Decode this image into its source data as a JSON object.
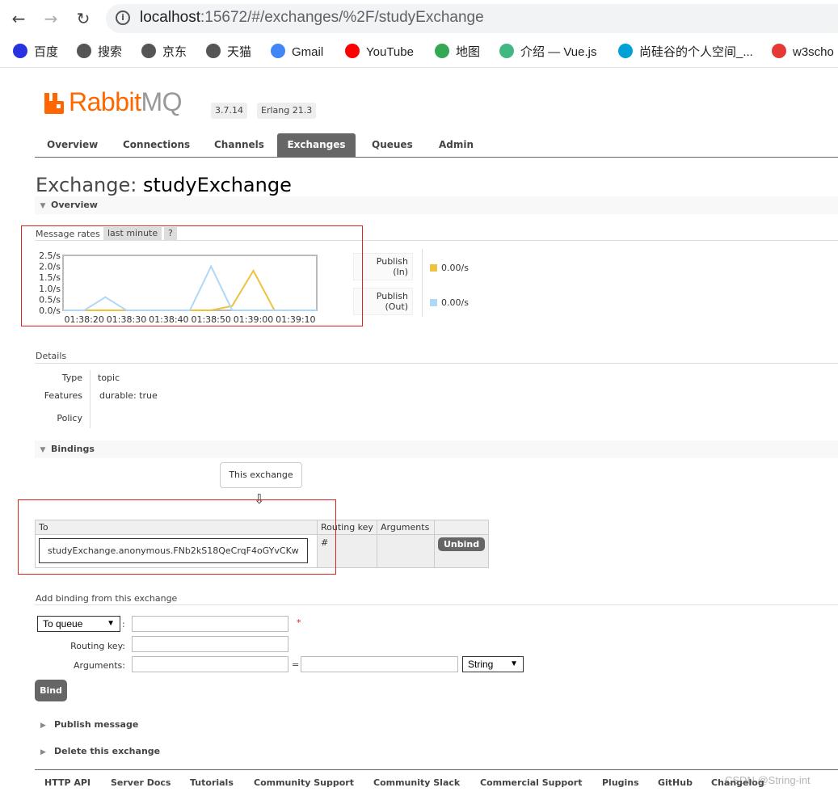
{
  "browser": {
    "url_host": "localhost",
    "url_rest": ":15672/#/exchanges/%2F/studyExchange",
    "bookmarks": [
      {
        "label": "百度",
        "icon": "baidu-icon",
        "color": "#2932e1"
      },
      {
        "label": "搜索",
        "icon": "globe-icon",
        "color": "#555555"
      },
      {
        "label": "京东",
        "icon": "globe-icon",
        "color": "#555555"
      },
      {
        "label": "天猫",
        "icon": "globe-icon",
        "color": "#555555"
      },
      {
        "label": "Gmail",
        "icon": "google-icon",
        "color": "#4285f4"
      },
      {
        "label": "YouTube",
        "icon": "youtube-icon",
        "color": "#ff0000"
      },
      {
        "label": "地图",
        "icon": "maps-icon",
        "color": "#34a853"
      },
      {
        "label": "介绍 — Vue.js",
        "icon": "vue-icon",
        "color": "#41b883"
      },
      {
        "label": "尚硅谷的个人空间_...",
        "icon": "bilibili-icon",
        "color": "#00a1d6"
      },
      {
        "label": "w3scho",
        "icon": "w3school-icon",
        "color": "#e53935"
      }
    ]
  },
  "header": {
    "logo_rabbit": "Rabbit",
    "logo_mq": "MQ",
    "version": "3.7.14",
    "erlang": "Erlang 21.3"
  },
  "tabs": [
    "Overview",
    "Connections",
    "Channels",
    "Exchanges",
    "Queues",
    "Admin"
  ],
  "title": {
    "prefix": "Exchange:",
    "name": "studyExchange"
  },
  "overview": {
    "heading": "Overview",
    "rates_label": "Message rates",
    "range_label": "last minute",
    "help_label": "?",
    "legend": [
      {
        "label_1": "Publish",
        "label_2": "(In)",
        "value": "0.00/s",
        "color": "#edc240"
      },
      {
        "label_1": "Publish",
        "label_2": "(Out)",
        "value": "0.00/s",
        "color": "#afd8f8"
      }
    ]
  },
  "chart_data": {
    "type": "line",
    "x": [
      "01:38:15",
      "01:38:20",
      "01:38:25",
      "01:38:30",
      "01:38:35",
      "01:38:40",
      "01:38:45",
      "01:38:50",
      "01:38:55",
      "01:39:00",
      "01:39:05",
      "01:39:10",
      "01:39:15"
    ],
    "x_tick_labels": [
      "01:38:20",
      "01:38:30",
      "01:38:40",
      "01:38:50",
      "01:39:00",
      "01:39:10"
    ],
    "y_tick_labels": [
      "2.5/s",
      "2.0/s",
      "1.5/s",
      "1.0/s",
      "0.5/s",
      "0.0/s"
    ],
    "ylim": [
      0,
      2.5
    ],
    "series": [
      {
        "name": "Publish (In)",
        "color": "#edc240",
        "values": [
          0,
          0,
          0,
          0,
          0,
          0,
          0,
          0,
          0.2,
          1.8,
          0,
          0,
          0
        ]
      },
      {
        "name": "Publish (Out)",
        "color": "#afd8f8",
        "values": [
          0,
          0,
          0.6,
          0,
          0,
          0,
          0,
          2.0,
          0,
          0,
          0,
          0,
          0
        ]
      }
    ]
  },
  "details": {
    "heading": "Details",
    "rows": [
      {
        "label": "Type",
        "value": "topic"
      },
      {
        "label": "Features",
        "value": "durable: true"
      },
      {
        "label": "Policy",
        "value": ""
      }
    ]
  },
  "bindings": {
    "heading": "Bindings",
    "this_exchange": "This exchange",
    "arrow": "⇩",
    "columns": [
      "To",
      "Routing key",
      "Arguments",
      ""
    ],
    "rows": [
      {
        "to": "studyExchange.anonymous.FNb2kS18QeCrqF4oGYvCKw",
        "routing_key": "#",
        "arguments": "",
        "action": "Unbind"
      }
    ]
  },
  "add_binding": {
    "heading": "Add binding from this exchange",
    "destination_type": "To queue",
    "required_mark": "*",
    "routing_key_label": "Routing key:",
    "arguments_label": "Arguments:",
    "equals": "=",
    "arg_type": "String",
    "bind_label": "Bind",
    "colon": ":"
  },
  "collapsed_sections": [
    "Publish message",
    "Delete this exchange"
  ],
  "footer": [
    "HTTP API",
    "Server Docs",
    "Tutorials",
    "Community Support",
    "Community Slack",
    "Commercial Support",
    "Plugins",
    "GitHub",
    "Changelog"
  ],
  "watermark": "CSDN @String-int"
}
